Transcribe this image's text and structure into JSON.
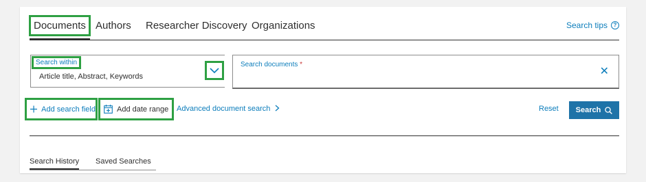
{
  "tabs": [
    {
      "label": "Documents",
      "active": true
    },
    {
      "label": "Authors",
      "active": false
    },
    {
      "label": "Researcher Discovery",
      "active": false
    },
    {
      "label": "Organizations",
      "active": false
    }
  ],
  "search_tips": {
    "label": "Search tips",
    "icon": "question-circle-icon"
  },
  "search_within": {
    "label": "Search within",
    "value": "Article title, Abstract, Keywords",
    "icon": "chevron-down-icon"
  },
  "search_documents": {
    "label": "Search documents",
    "required_marker": "*",
    "clear_icon": "close-icon"
  },
  "actions": {
    "add_search_field": "Add search field",
    "add_date_range": "Add date range",
    "advanced_search": "Advanced document search",
    "reset": "Reset",
    "search": "Search"
  },
  "history_tabs": [
    {
      "label": "Search History",
      "active": true
    },
    {
      "label": "Saved Searches",
      "active": false
    }
  ],
  "colors": {
    "link": "#0c7dbb",
    "primary_button": "#1e73a8",
    "highlight": "#2ea043",
    "required": "#c83737"
  }
}
